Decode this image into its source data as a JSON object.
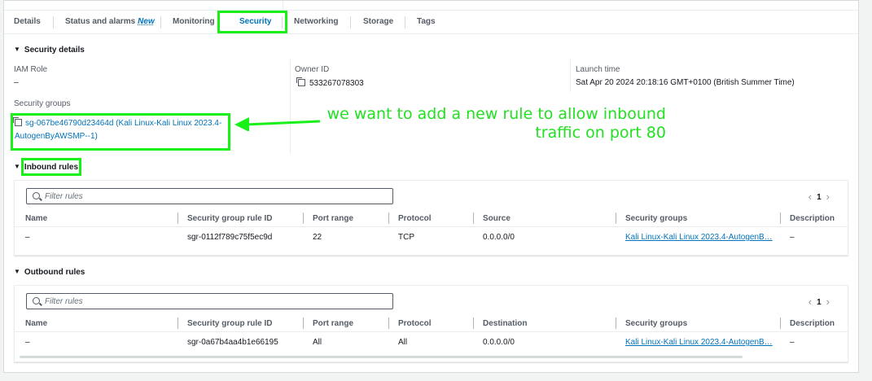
{
  "tabs": [
    {
      "label": "Details"
    },
    {
      "label": "Status and alarms",
      "badge": "New"
    },
    {
      "label": "Monitoring"
    },
    {
      "label": "Security"
    },
    {
      "label": "Networking"
    },
    {
      "label": "Storage"
    },
    {
      "label": "Tags"
    }
  ],
  "active_tab": "Security",
  "security_details": {
    "heading": "Security details",
    "iam_role_label": "IAM Role",
    "iam_role_value": "–",
    "owner_id_label": "Owner ID",
    "owner_id_value": "533267078303",
    "launch_time_label": "Launch time",
    "launch_time_value": "Sat Apr 20 2024 20:18:16 GMT+0100 (British Summer Time)",
    "security_groups_label": "Security groups",
    "security_group_link": "sg-067be46790d23464d (Kali Linux-Kali Linux 2023.4-AutogenByAWSMP--1)"
  },
  "annotation": {
    "line1": "we want to add a new rule to allow inbound",
    "line2": "traffic on port 80"
  },
  "inbound": {
    "heading": "Inbound rules",
    "filter_placeholder": "Filter rules",
    "page": "1",
    "columns": [
      "Name",
      "Security group rule ID",
      "Port range",
      "Protocol",
      "Source",
      "Security groups",
      "Description"
    ],
    "rows": [
      {
        "name": "–",
        "rule_id": "sgr-0112f789c75f5ec9d",
        "port_range": "22",
        "protocol": "TCP",
        "source": "0.0.0.0/0",
        "security_groups": "Kali Linux-Kali Linux 2023.4-AutogenB…",
        "description": "–"
      }
    ]
  },
  "outbound": {
    "heading": "Outbound rules",
    "filter_placeholder": "Filter rules",
    "page": "1",
    "columns": [
      "Name",
      "Security group rule ID",
      "Port range",
      "Protocol",
      "Destination",
      "Security groups",
      "Description"
    ],
    "rows": [
      {
        "name": "–",
        "rule_id": "sgr-0a67b4aa4b1e66195",
        "port_range": "All",
        "protocol": "All",
        "destination": "0.0.0.0/0",
        "security_groups": "Kali Linux-Kali Linux 2023.4-AutogenB…",
        "description": "–"
      }
    ]
  },
  "colors": {
    "highlight": "#19f019",
    "annotation_text": "#22e022",
    "link": "#0073bb"
  },
  "icons": [
    "caret-down-icon",
    "copy-icon",
    "search-icon",
    "chevron-left-icon",
    "chevron-right-icon",
    "arrow-annotation-icon"
  ]
}
